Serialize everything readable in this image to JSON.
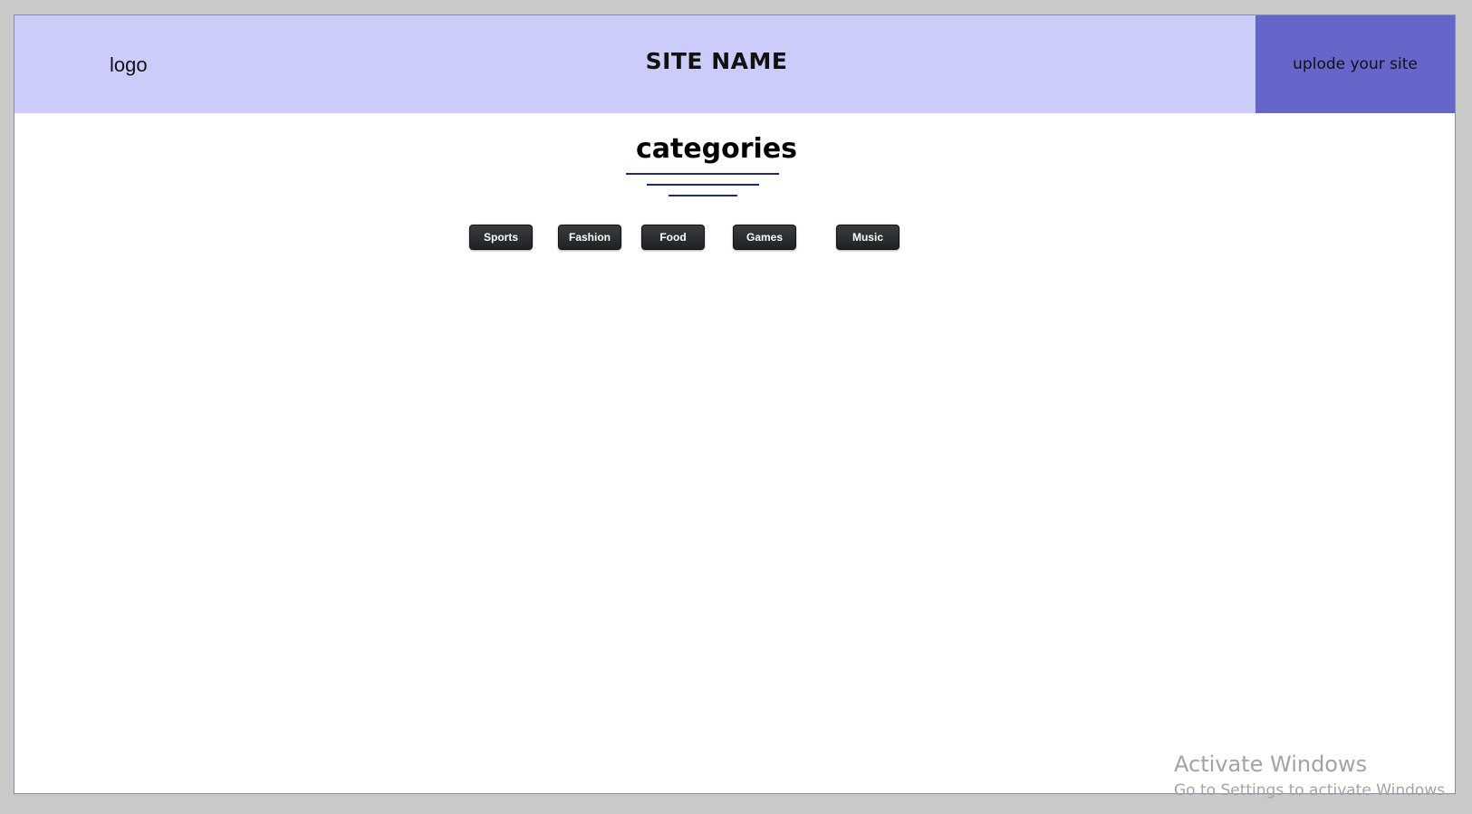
{
  "header": {
    "logo_text": "logo",
    "site_name": "SITE NAME",
    "upload_label": "uplode your site"
  },
  "main": {
    "heading": "categories",
    "categories": [
      {
        "label": "Sports"
      },
      {
        "label": "Fashion"
      },
      {
        "label": "Food"
      },
      {
        "label": "Games"
      },
      {
        "label": "Music"
      }
    ]
  },
  "watermark": {
    "title": "Activate Windows",
    "subtitle": "Go to Settings to activate Windows."
  },
  "colors": {
    "header_bg": "#ccccfb",
    "upload_bg": "#6665c9",
    "button_bg": "#2b2e30",
    "underline": "#1a2a7a"
  }
}
